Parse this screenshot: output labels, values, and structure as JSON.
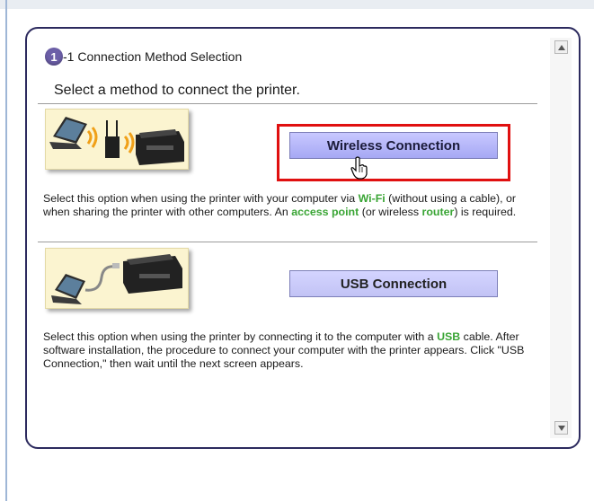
{
  "panel": {
    "step_number": "1",
    "title": "-1 Connection Method Selection",
    "subtitle": "Select a method to connect the printer."
  },
  "wireless": {
    "button_label": "Wireless Connection",
    "desc": {
      "t1": "Select this option when using the printer with your computer via ",
      "k1": "Wi-Fi",
      "t2": " (without using a cable), or when sharing the printer with other computers. An ",
      "k2": "access point",
      "t3": " (or wireless ",
      "k3": "router",
      "t4": ") is required."
    }
  },
  "usb": {
    "button_label": "USB Connection",
    "desc": {
      "t1": "Select this option when using the printer by connecting it to the computer with a ",
      "k1": "USB",
      "t2": " cable. After software installation, the procedure to connect your computer with the printer appears. Click \"USB Connection,\" then wait until the next screen appears."
    }
  },
  "colors": {
    "keyword": "#3aa535",
    "highlight": "#e01010",
    "button": "#a6a8f4",
    "border": "#2c2a5e"
  },
  "icons": [
    "hand-cursor-icon",
    "scroll-up-arrow-icon",
    "scroll-down-arrow-icon"
  ]
}
